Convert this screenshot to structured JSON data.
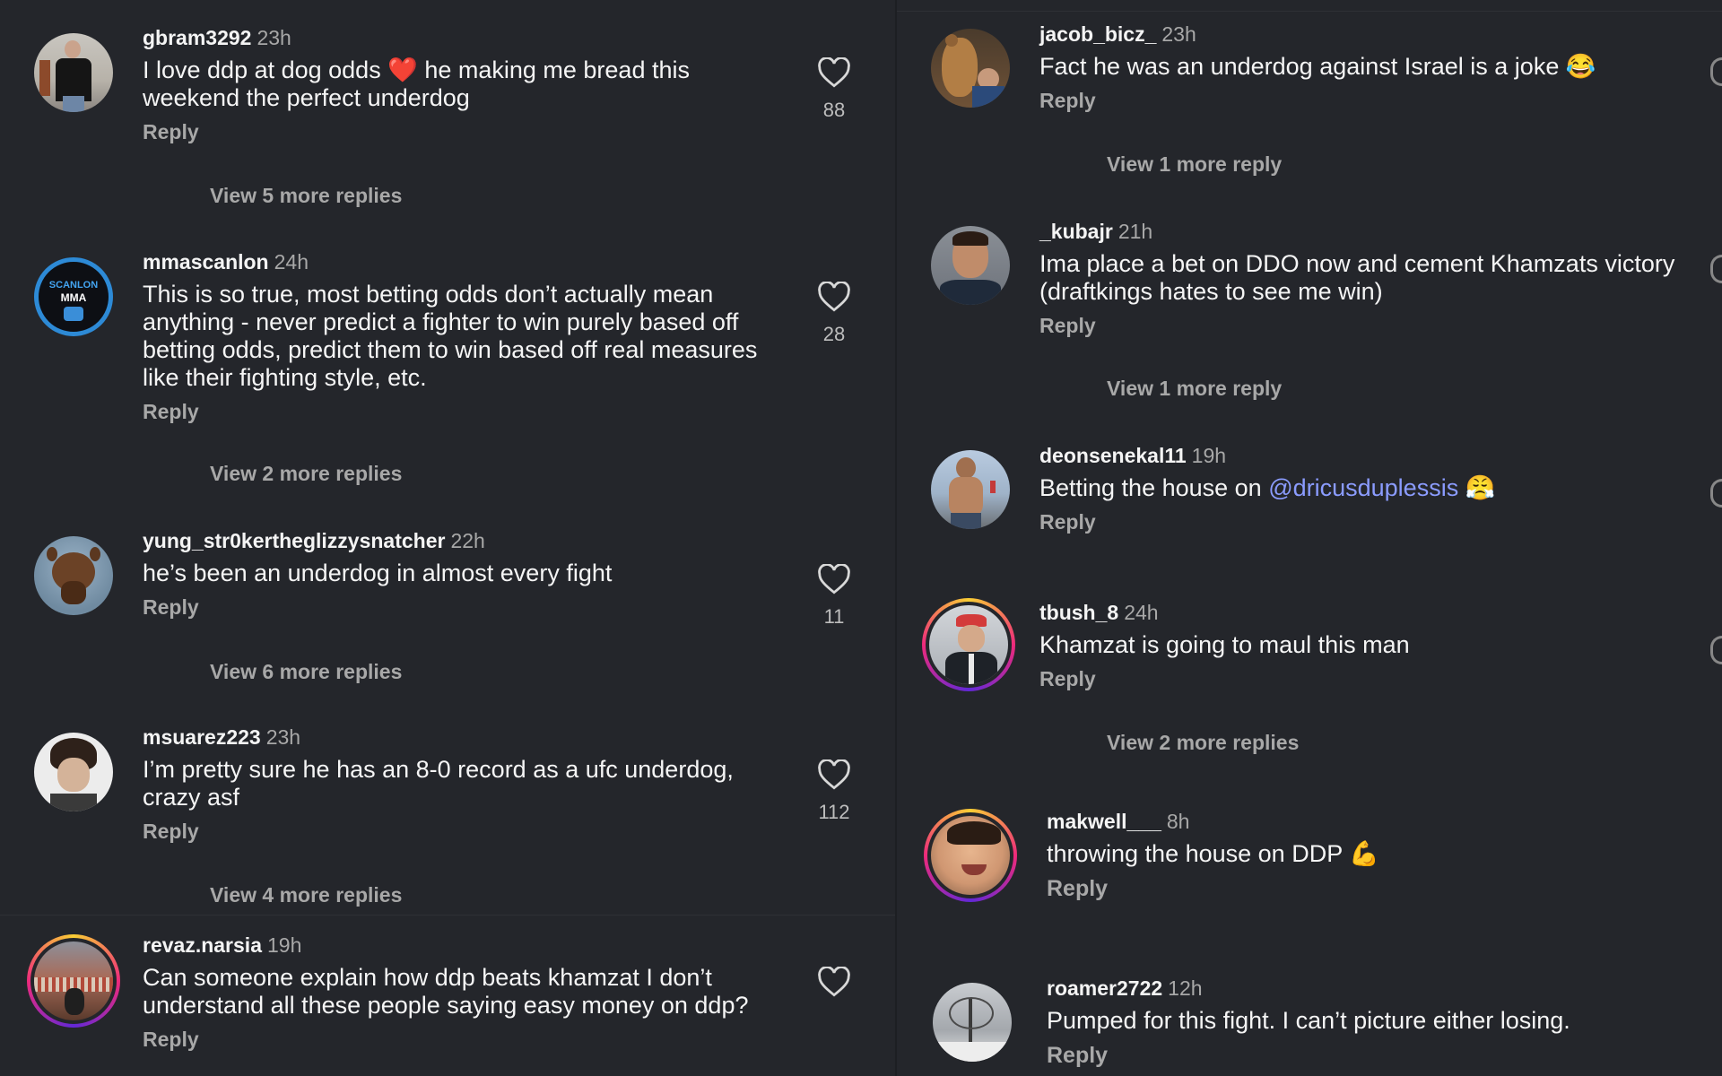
{
  "reply_label": "Reply",
  "left": [
    {
      "username": "gbram3292",
      "time": "23h",
      "text": "I love ddp at dog odds ❤️ he making me bread this weekend the perfect underdog",
      "likes": "88",
      "view_more": "View 5 more replies",
      "avatar": "person-black-shirt",
      "ring": false
    },
    {
      "username": "mmascanlon",
      "time": "24h",
      "text": "This is so true, most betting odds don’t actually mean anything - never predict a fighter to win purely based off betting odds, predict them to win based off real measures like their fighting style, etc.",
      "likes": "28",
      "view_more": "View 2 more replies",
      "avatar": "scanlon-mma-logo",
      "ring": false
    },
    {
      "username": "yung_str0kertheglizzysnatcher",
      "time": "22h",
      "text": "he’s been an underdog in almost every fight",
      "likes": "11",
      "view_more": "View 6 more replies",
      "avatar": "horse",
      "ring": false
    },
    {
      "username": "msuarez223",
      "time": "23h",
      "text": "I’m pretty sure he has an 8-0 record as a ufc underdog, crazy asf",
      "likes": "112",
      "view_more": "View 4 more replies",
      "avatar": "curly-hair-person",
      "ring": false
    },
    {
      "username": "revaz.narsia",
      "time": "19h",
      "text": "Can someone explain how ddp beats khamzat I don’t understand all these people saying easy money on ddp?",
      "likes": "",
      "view_more": "",
      "avatar": "stadium-crowd",
      "ring": true
    }
  ],
  "right": [
    {
      "username": "jacob_bicz_",
      "time": "23h",
      "text": "Fact he was an underdog against Israel is a joke 😂",
      "view_more": "View 1 more reply",
      "avatar": "bear-photo",
      "ring": false
    },
    {
      "username": "_kubajr",
      "time": "21h",
      "text": "Ima place a bet on DDO now and cement Khamzats victory (draftkings hates to see me win)",
      "view_more": "View 1 more reply",
      "avatar": "smiling-man",
      "ring": false
    },
    {
      "username": "deonsenekal11",
      "time": "19h",
      "text_before": "Betting the house on ",
      "mention": "@dricusduplessis",
      "text_after": " 😤",
      "view_more": "",
      "avatar": "shirtless-man",
      "ring": false
    },
    {
      "username": "tbush_8",
      "time": "24h",
      "text": "Khamzat is going to maul this man",
      "view_more": "View 2 more replies",
      "avatar": "man-red-cap",
      "ring": true
    },
    {
      "username": "makwell___",
      "time": "8h",
      "text": "throwing the house on DDP 💪",
      "view_more": "",
      "avatar": "laughing-child",
      "ring": true
    },
    {
      "username": "roamer2722",
      "time": "12h",
      "text": "Pumped for this fight. I can’t picture either losing.",
      "view_more": "",
      "avatar": "winter-trees",
      "ring": false
    }
  ],
  "colors": {
    "background": "#24262b",
    "mention": "#8b9cff",
    "muted": "#a8a8a8"
  },
  "avatar_text": {
    "scanlon_top": "SCANLON",
    "scanlon_bottom": "MMA"
  }
}
